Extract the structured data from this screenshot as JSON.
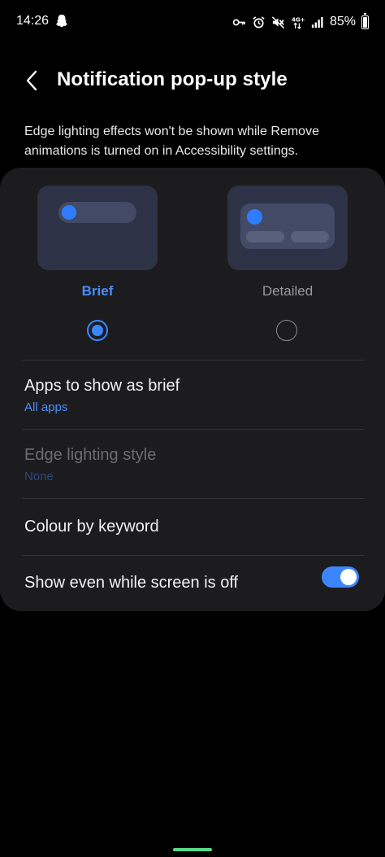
{
  "status_bar": {
    "time": "14:26",
    "left_icons": [
      "snapchat-ghost-icon"
    ],
    "right_icons": [
      "key-icon",
      "alarm-icon",
      "mute-icon",
      "data-4g-icon",
      "signal-icon"
    ],
    "battery_text": "85%",
    "battery_level": 0.85
  },
  "header": {
    "back_icon": "chevron-left-icon",
    "title": "Notification pop-up style"
  },
  "description": "Edge lighting effects won't be shown while Remove animations is turned on in Accessibility settings.",
  "styles": {
    "brief_label": "Brief",
    "detailed_label": "Detailed",
    "selected": "Brief"
  },
  "settings": {
    "apps_brief_title": "Apps to show as brief",
    "apps_brief_value": "All apps",
    "edge_lighting_title": "Edge lighting style",
    "edge_lighting_value": "None",
    "colour_keyword_title": "Colour by keyword",
    "screen_off_title": "Show even while screen is off",
    "screen_off_enabled": true
  },
  "colors": {
    "accent": "#3b86ff",
    "background": "#000000",
    "card": "#1c1c1e",
    "home_indicator": "#5bd98a"
  }
}
